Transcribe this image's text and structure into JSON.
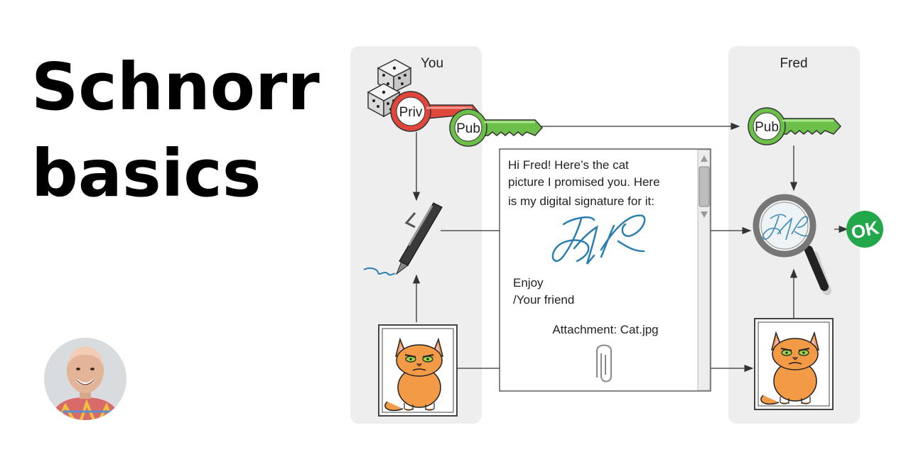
{
  "title": {
    "line1": "Schnorr",
    "line2": "basics"
  },
  "diagram": {
    "you_label": "You",
    "fred_label": "Fred",
    "priv_key_label": "Priv",
    "pub_key_label_you": "Pub",
    "pub_key_label_fred": "Pub",
    "message": {
      "line1": "Hi Fred! Here’s the cat",
      "line2": "picture I promised you. Here",
      "line3": "is my digital signature for it:",
      "enjoy": "Enjoy",
      "sign_off": "/Your friend",
      "attachment": "Attachment: Cat.jpg"
    },
    "ok_label": "OK",
    "colors": {
      "panel": "#eeeeee",
      "priv_key": "#e0463a",
      "pub_key": "#6cc04a",
      "signature": "#2a7fb0",
      "ok_badge": "#22a84a"
    }
  }
}
